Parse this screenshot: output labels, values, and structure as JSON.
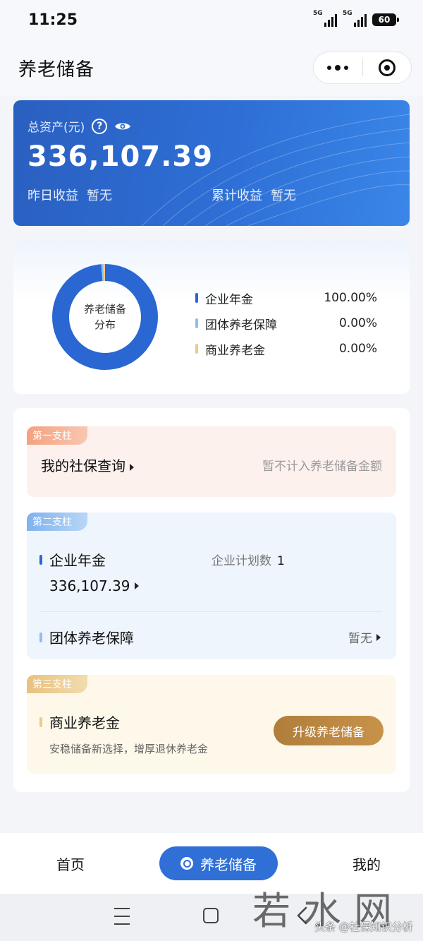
{
  "status_bar": {
    "time": "11:25",
    "signal1": "5G",
    "signal2": "5G",
    "battery": "60"
  },
  "header": {
    "title": "养老储备"
  },
  "asset": {
    "label": "总资产(元)",
    "help_glyph": "?",
    "total": "336,107.39",
    "yesterday_label": "昨日收益",
    "yesterday_value": "暂无",
    "cumulative_label": "累计收益",
    "cumulative_value": "暂无"
  },
  "distribution": {
    "center_line1": "养老储备",
    "center_line2": "分布",
    "items": [
      {
        "name": "企业年金",
        "percent": "100.00%",
        "share": 1.0,
        "color": "#2a67d2"
      },
      {
        "name": "团体养老保障",
        "percent": "0.00%",
        "share": 0.0,
        "color": "#8fbff0"
      },
      {
        "name": "商业养老金",
        "percent": "0.00%",
        "share": 0.0,
        "color": "#efc98a"
      }
    ]
  },
  "pillars": {
    "first": {
      "tag": "第一支柱",
      "title": "我的社保查询",
      "hint": "暂不计入养老储备金额"
    },
    "second": {
      "tag": "第二支柱",
      "enterprise_label": "企业年金",
      "plan_label": "企业计划数",
      "plan_count": "1",
      "enterprise_value": "336,107.39",
      "group_label": "团体养老保障",
      "group_value": "暂无"
    },
    "third": {
      "tag": "第三支柱",
      "title": "商业养老金",
      "desc": "安稳储备新选择，增厚退休养老金",
      "button": "升级养老储备"
    }
  },
  "tabbar": {
    "home": "首页",
    "reserve": "养老储备",
    "mine": "我的"
  },
  "watermark": {
    "big": "若水网",
    "small": "头条 @社保知识分析"
  },
  "colors": {
    "primary": "#2f6fd6",
    "accent_gold": "#b98540"
  }
}
